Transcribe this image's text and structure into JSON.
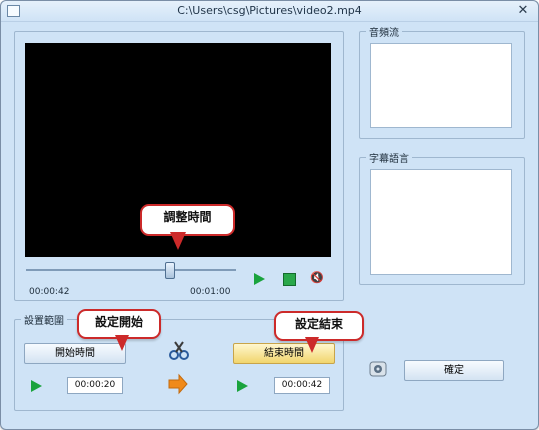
{
  "window": {
    "title": "C:\\Users\\csg\\Pictures\\video2.mp4"
  },
  "player": {
    "current_time": "00:00:42",
    "total_time": "00:01:00",
    "position_fraction": 0.7
  },
  "labels": {
    "range_group": "設置範圍",
    "audio_stream": "音頻流",
    "subtitle_language": "字幕語言"
  },
  "buttons": {
    "start_time": "開始時間",
    "end_time": "結束時間",
    "ok": "確定"
  },
  "times": {
    "start": "00:00:20",
    "end": "00:00:42"
  },
  "callouts": {
    "adjust_time": "調整時間",
    "set_start": "設定開始",
    "set_end": "設定結束"
  },
  "colors": {
    "window_bg": "#cfe3f6",
    "callout_border": "#cc2a2a",
    "gold_button": "#f1d56d"
  }
}
